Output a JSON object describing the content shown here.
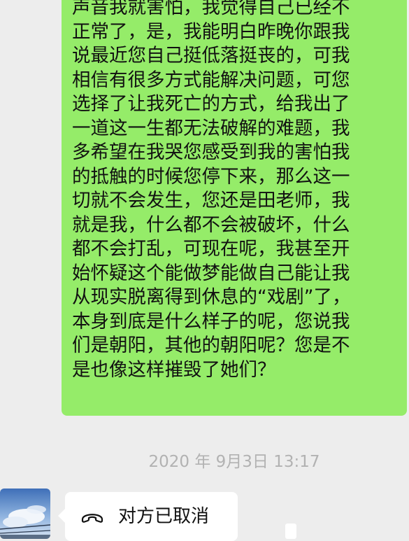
{
  "messages": {
    "sent_lines": [
      "声音我就害怕，我觉得自己已经不",
      "正常了，是，我能明白昨晚你跟我",
      "说最近您自己挺低落挺丧的，可我",
      "相信有很多方式能解决问题，可您",
      "选择了让我死亡的方式，给我出了",
      "一道这一生都无法破解的难题，我",
      "多希望在我哭您感受到我的害怕我",
      "的抵触的时候您停下来，那么这一",
      "切就不会发生，您还是田老师，我",
      "就是我，什么都不会被破坏，什么",
      "都不会打乱，可现在呢，我甚至开",
      "始怀疑这个能做梦能做自己能让我",
      "从现实脱离得到休息的“戏剧”了，",
      "本身到底是什么样子的呢，您说我",
      "们是朝阳，其他的朝阳呢？您是不",
      "是也像这样摧毁了她们？"
    ],
    "timestamp": "2020 年 9月3日  13:17",
    "call_status": "对方已取消"
  },
  "colors": {
    "background": "#ededed",
    "sent_bubble": "#95ec69",
    "received_bubble": "#ffffff",
    "timestamp_text": "#b2b2b2"
  },
  "icons": {
    "call": "phone-cancelled-icon"
  }
}
